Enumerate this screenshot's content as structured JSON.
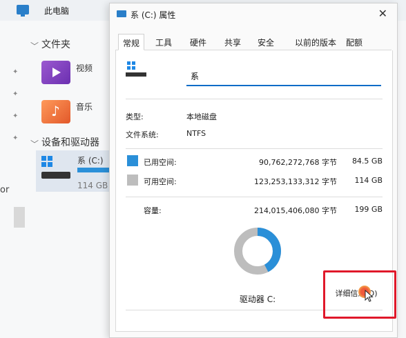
{
  "explorer": {
    "title": "此电脑",
    "sidebar": {
      "quick_access": "文件夹",
      "video": "视频",
      "music": "音乐",
      "devices": "设备和驱动器",
      "drive_name": "系 (C:)",
      "drive_free": "114 GB",
      "left_fragment": "or"
    }
  },
  "dialog": {
    "title": "系 (C:) 属性",
    "close": "✕",
    "tabs": [
      "常规",
      "工具",
      "硬件",
      "共享",
      "安全",
      "以前的版本",
      "配额"
    ],
    "name_value": "系",
    "type_label": "类型:",
    "type_value": "本地磁盘",
    "fs_label": "文件系统:",
    "fs_value": "NTFS",
    "used": {
      "label": "已用空间:",
      "bytes": "90,762,272,768 字节",
      "size": "84.5 GB",
      "color": "#2a8fd8"
    },
    "free": {
      "label": "可用空间:",
      "bytes": "123,253,133,312 字节",
      "size": "114 GB",
      "color": "#bdbdbd"
    },
    "capacity": {
      "label": "容量:",
      "bytes": "214,015,406,080 字节",
      "size": "199 GB"
    },
    "used_fraction": 0.424,
    "drive_caption": "驱动器 C:",
    "details_button": "详细信息(D)"
  }
}
